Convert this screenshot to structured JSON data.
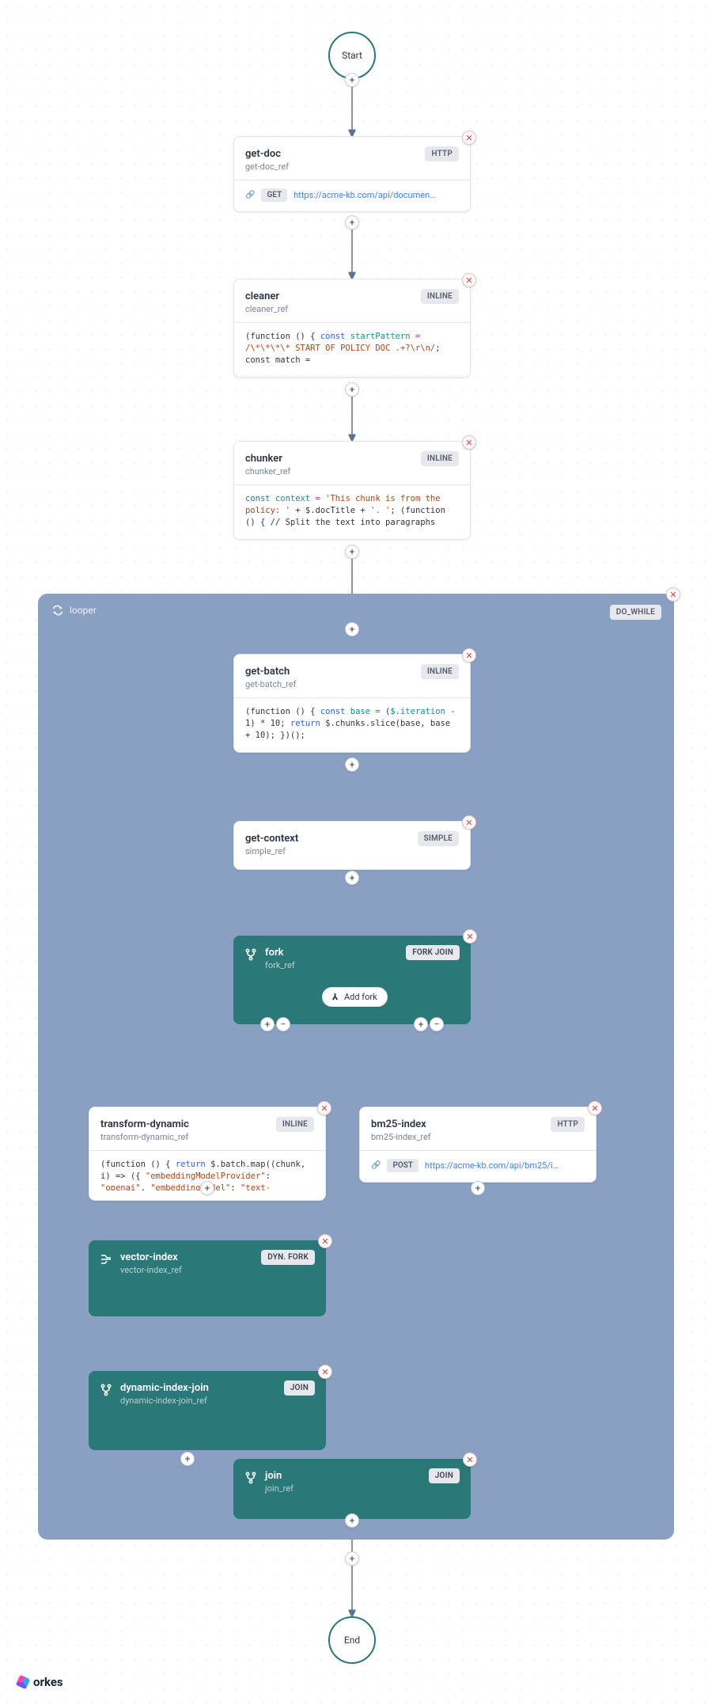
{
  "flow": {
    "start": "Start",
    "end": "End",
    "logo": "orkes"
  },
  "tasks": {
    "get_doc": {
      "name": "get-doc",
      "ref": "get-doc_ref",
      "type": "HTTP",
      "method": "GET",
      "url": "https://acme-kb.com/api/documen…"
    },
    "cleaner": {
      "name": "cleaner",
      "ref": "cleaner_ref",
      "type": "INLINE"
    },
    "chunker": {
      "name": "chunker",
      "ref": "chunker_ref",
      "type": "INLINE"
    },
    "looper": {
      "name": "looper",
      "type": "DO_WHILE"
    },
    "get_batch": {
      "name": "get-batch",
      "ref": "get-batch_ref",
      "type": "INLINE"
    },
    "get_ctx": {
      "name": "get-context",
      "ref": "simple_ref",
      "type": "SIMPLE"
    },
    "fork": {
      "name": "fork",
      "ref": "fork_ref",
      "type": "FORK JOIN",
      "add_fork": "Add fork"
    },
    "t_dyn": {
      "name": "transform-dynamic",
      "ref": "transform-dynamic_ref",
      "type": "INLINE"
    },
    "bm25": {
      "name": "bm25-index",
      "ref": "bm25-index_ref",
      "type": "HTTP",
      "method": "POST",
      "url": "https://acme-kb.com/api/bm25/i…"
    },
    "vector": {
      "name": "vector-index",
      "ref": "vector-index_ref",
      "type": "DYN. FORK"
    },
    "dyn_join": {
      "name": "dynamic-index-join",
      "ref": "dynamic-index-join_ref",
      "type": "JOIN"
    },
    "join": {
      "name": "join",
      "ref": "join_ref",
      "type": "JOIN"
    }
  },
  "code": {
    "cleaner": {
      "pre": "(function () { ",
      "kw": "const",
      "id": " startPattern",
      "op": " = ",
      "str": "/\\*\\*\\*\\* START OF POLICY DOC .+?\\r\\n/",
      "tail": ";\nconst match ="
    },
    "chunker": {
      "kw1": "const",
      "id1": " context",
      "op": " = ",
      "str": "'This chunk is from the policy: '",
      "plus": " + $.docTitle + ",
      "str2": "'. '",
      "tail": "; (function () { // Split the text into paragraphs"
    },
    "get_batch": {
      "pre": "(function () { ",
      "kw": "const",
      "id": " base",
      "op": " = ",
      "expr": "(",
      "var": "$.iteration",
      "expr2": " - 1) * 10; ",
      "kw2": "return",
      "rest": " $.chunks.slice(base, base + 10); })();"
    },
    "t_dyn": {
      "pre": "(function () { ",
      "kw": "return",
      "rest": " $.batch.map((chunk, i) => ({ ",
      "str": "\"embeddingModelProvider\"",
      "rest2": ": ",
      "str2": "\"openai\"",
      "rest3": ", ",
      "str3": "\"embeddingModel\"",
      "rest4": ": ",
      "str4": "\"text-"
    }
  }
}
